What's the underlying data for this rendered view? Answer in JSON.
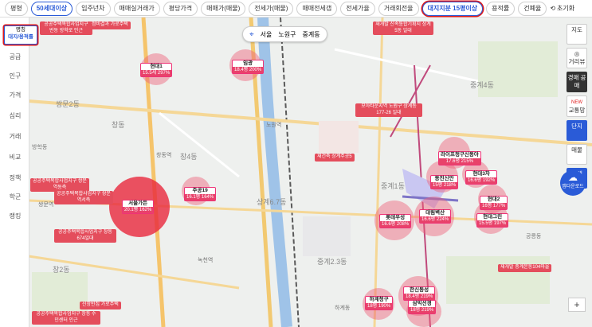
{
  "filters": [
    "평형",
    "50세대이상",
    "입주년차",
    "매매실거래가",
    "평당가격",
    "매매가(매물)",
    "전세가(매물)",
    "매매전세갭",
    "전세가율",
    "거래회전율",
    "대지지분 15평이상",
    "용적률",
    "건폐율"
  ],
  "reset_label": "초기화",
  "left_menu": {
    "selected_title": "명칭",
    "selected_sub": "대지/용적률",
    "items": [
      "공급",
      "인구",
      "가격",
      "심리",
      "거래",
      "비교",
      "정책",
      "학군",
      "랭킹"
    ]
  },
  "location": {
    "city": "서울",
    "district": "노원구",
    "dong": "중계동"
  },
  "right_menu": [
    "지도",
    "거리뷰",
    "경매 공매",
    "교통망",
    "단지",
    "매물",
    "중개"
  ],
  "right_new_badge": "NEW",
  "fab_label": "앱다운로드",
  "zoom": {
    "in": "+",
    "out": "−"
  },
  "complexes": [
    {
      "name": "현대1",
      "value": "15.5세 297%"
    },
    {
      "name": "임광",
      "value": "18.4평 200%"
    },
    {
      "name": "주공19",
      "value": "16.1평 164%"
    },
    {
      "name": "서울가든",
      "value": "20.1평 162%"
    },
    {
      "name": "라이프청구신동아",
      "value": "17.6평 215%"
    },
    {
      "name": "현대3차",
      "value": "16.6평 192%"
    },
    {
      "name": "동진신안",
      "value": "15평 218%"
    },
    {
      "name": "롯데우성",
      "value": "16.6평 208%"
    },
    {
      "name": "대림벽산",
      "value": "16.6평 224%"
    },
    {
      "name": "현대2",
      "value": "16평 177%"
    },
    {
      "name": "현대그린",
      "value": "15.5평 197%"
    },
    {
      "name": "한신동성",
      "value": "18.4평 219%"
    },
    {
      "name": "하계청구",
      "value": "18평 190%"
    },
    {
      "name": "삼익선경",
      "value": "18평 219%"
    }
  ],
  "notices": [
    "공공주택복합사업지구 번동 방학로 인근",
    "정비결과 가로주택",
    "재개발 신속통합기획지 상계5동 일대",
    "모아타운지역 노원구 상계동 177-26 일대",
    "재건축 상계주공5",
    "공공주택복합사업지구 쌍문역동측",
    "공공주택복합사업지구 쌍문역서측",
    "공공주택복합사업지구 창동 674일대",
    "재개발 중계본동104마을",
    "신창빈집 가로주택",
    "공공주택복합사업지구 창동 수민센터 인근"
  ],
  "map_labels": [
    "쌍문2동",
    "창동",
    "창4동",
    "상계6.7동",
    "중계1동",
    "중계4동",
    "중계2.3동",
    "창2동",
    "방학동",
    "노원역",
    "창동역",
    "쌍문역",
    "하계동",
    "녹천역",
    "공릉동"
  ]
}
